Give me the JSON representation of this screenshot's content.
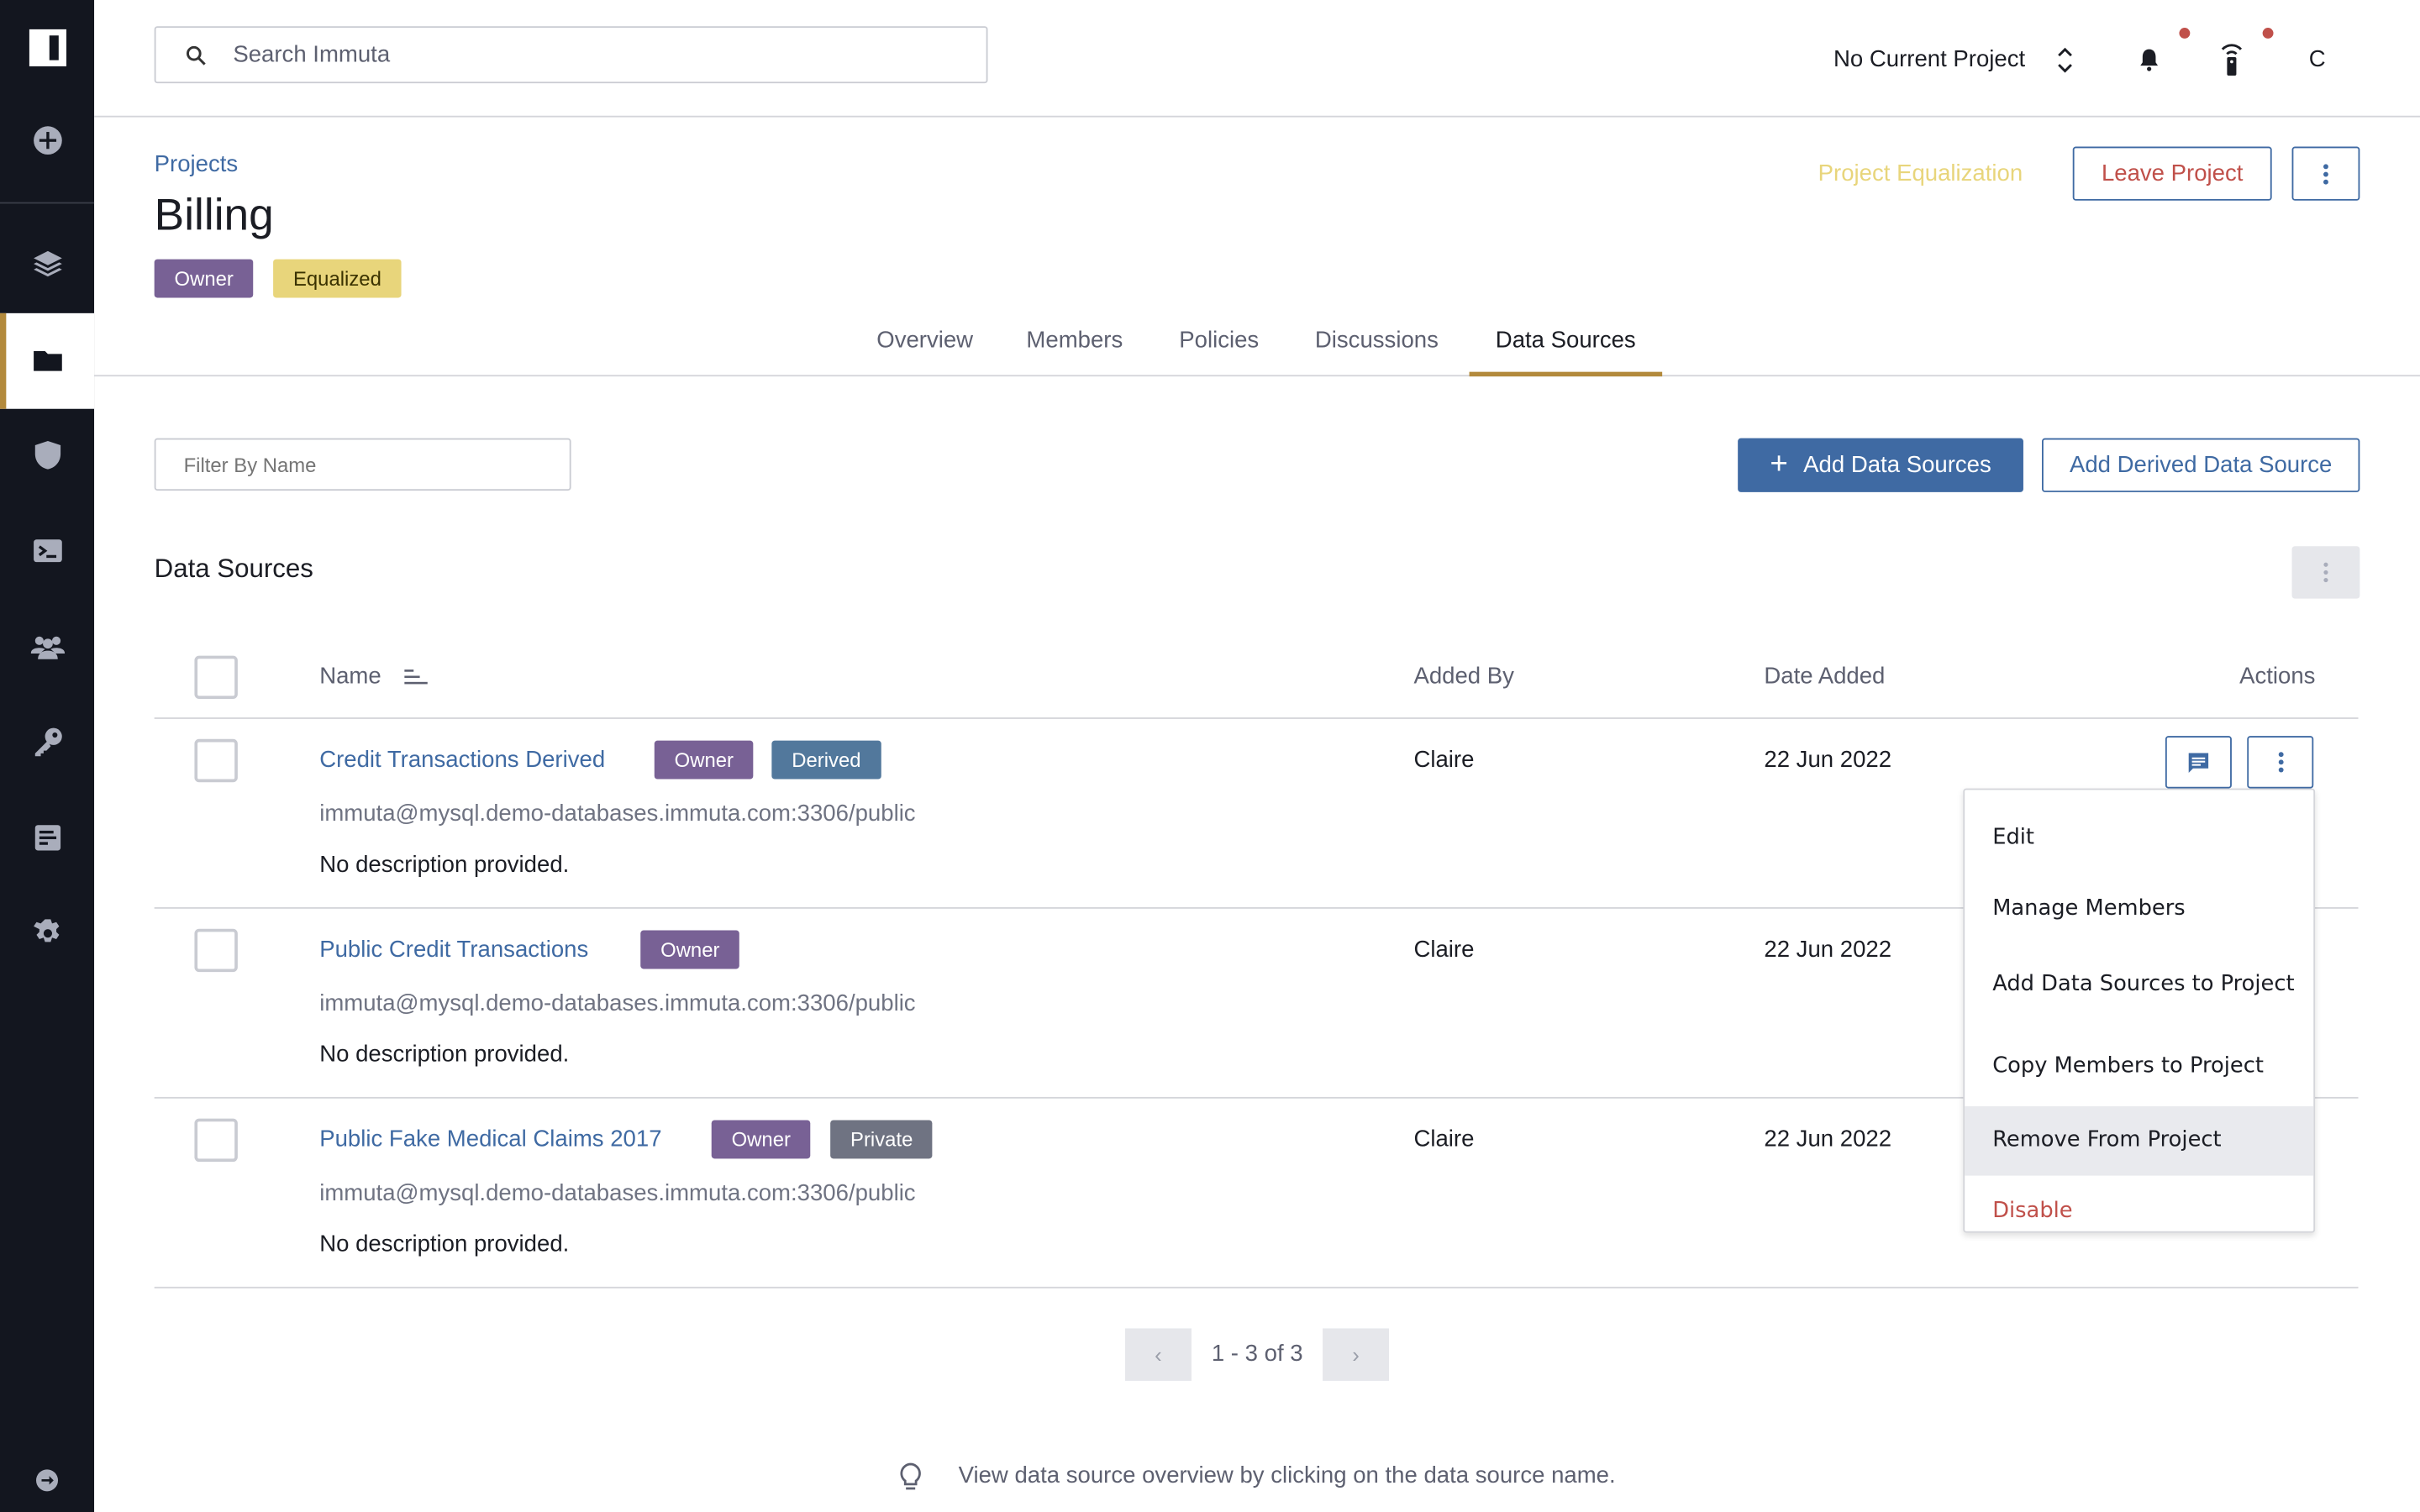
{
  "search": {
    "placeholder": "Search Immuta"
  },
  "topbar": {
    "project_selector": "No Current Project",
    "user_initial": "C",
    "notification_dot_color": "#c0504a"
  },
  "sidebar": {
    "items": [
      "logo",
      "add",
      "data-sources",
      "projects",
      "policies",
      "query-editor",
      "people",
      "keys",
      "audit",
      "settings",
      "collapse"
    ],
    "active": "projects",
    "accent": "#b38a3c"
  },
  "header": {
    "breadcrumb": "Projects",
    "title": "Billing",
    "badges": [
      "Owner",
      "Equalized"
    ],
    "equalization_link": "Project Equalization",
    "leave_button": "Leave Project"
  },
  "tabs": [
    {
      "label": "Overview"
    },
    {
      "label": "Members"
    },
    {
      "label": "Policies"
    },
    {
      "label": "Discussions"
    },
    {
      "label": "Data Sources",
      "active": true
    }
  ],
  "toolbar": {
    "filter_placeholder": "Filter By Name",
    "add_data_sources": "Add Data Sources",
    "add_derived": "Add Derived Data Source"
  },
  "section": {
    "title": "Data Sources"
  },
  "table": {
    "columns": [
      "Name",
      "Added By",
      "Date Added",
      "Actions"
    ],
    "rows": [
      {
        "name": "Credit Transactions Derived",
        "badges": [
          "Owner",
          "Derived"
        ],
        "url": "immuta@mysql.demo-databases.immuta.com:3306/public",
        "description": "No description provided.",
        "added_by": "Claire",
        "date_added": "22 Jun 2022"
      },
      {
        "name": "Public Credit Transactions",
        "badges": [
          "Owner"
        ],
        "url": "immuta@mysql.demo-databases.immuta.com:3306/public",
        "description": "No description provided.",
        "added_by": "Claire",
        "date_added": "22 Jun 2022"
      },
      {
        "name": "Public Fake Medical Claims 2017",
        "badges": [
          "Owner",
          "Private"
        ],
        "url": "immuta@mysql.demo-databases.immuta.com:3306/public",
        "description": "No description provided.",
        "added_by": "Claire",
        "date_added": "22 Jun 2022"
      }
    ]
  },
  "menu": {
    "items": [
      "Edit",
      "Manage Members",
      "Add Data Sources to Project",
      "Copy Members to Project",
      "Remove From Project",
      "Disable"
    ],
    "highlighted": "Remove From Project"
  },
  "pagination": {
    "label": "1 - 3 of 3"
  },
  "tip": "View data source overview by clicking on the data source name.",
  "colors": {
    "primary": "#3f6aa3",
    "danger": "#c0504a",
    "owner": "#786195",
    "derived": "#52789c",
    "private": "#6f7382",
    "equalized": "#e8d57b"
  }
}
